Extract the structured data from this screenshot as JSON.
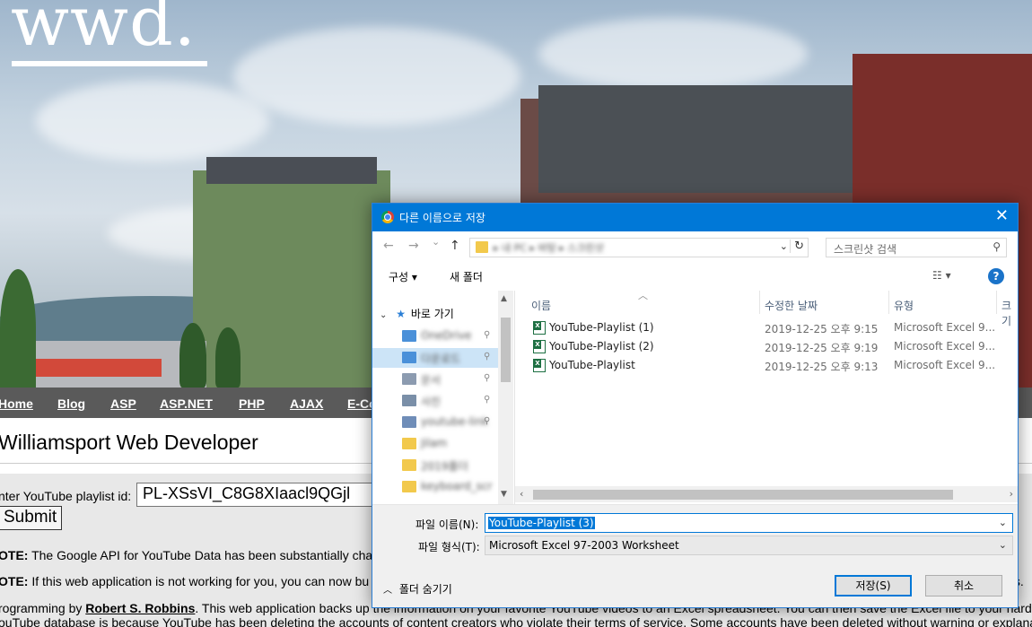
{
  "site": {
    "logo": "wwd.",
    "nav": [
      "Home",
      "Blog",
      "ASP",
      "ASP.NET",
      "PHP",
      "AJAX",
      "E-Co"
    ],
    "title": "Williamsport Web Developer",
    "playlist_label": "nter YouTube playlist id:",
    "playlist_value": "PL-XSsVI_C8G8XIaacl9QGjl",
    "submit_label": "Submit",
    "note1_bold": "OTE:",
    "note1_text": " The Google API for YouTube Data has been substantially cha",
    "note2_bold": "OTE:",
    "note2_text": " If this web application is not working for you, you can now bu",
    "note2_tail": "ts.",
    "credit_prefix": "rogramming by ",
    "credit_author": "Robert S. Robbins",
    "credit_text": ". This web application backs up the information on your favorite YouTube videos to an Excel spreadsheet. You can then save the Excel file to your hard",
    "line_last": "ouTube database is because YouTube has been deleting the accounts of content creators who violate their terms of service. Some accounts have been deleted without warning or explana"
  },
  "dialog": {
    "title": "다른 이름으로 저장",
    "close_glyph": "✕",
    "nav_back": "←",
    "nav_forward": "→",
    "nav_recent": "⌄",
    "nav_up": "↑",
    "address_path": "▸ 내 PC ▸ 바탕 ▸ 스크린샷",
    "search_placeholder": "스크린샷 검색",
    "toolbar": {
      "organize": "구성 ▾",
      "new_folder": "새 폴더",
      "view": "☷ ▾",
      "help": "?"
    },
    "nav_pane": {
      "quick_access": "바로 가기",
      "items": [
        {
          "label": "OneDrive",
          "color": "#4a90d9"
        },
        {
          "label": "다운로드",
          "color": "#4a90d9"
        },
        {
          "label": "문서",
          "color": "#8c9bb0"
        },
        {
          "label": "사진",
          "color": "#7a8fa8"
        },
        {
          "label": "youtube-link",
          "color": "#6f8db8"
        },
        {
          "label": "Jilam",
          "color": "#f2c94c"
        },
        {
          "label": "2019폴더",
          "color": "#f2c94c"
        },
        {
          "label": "keyboard_scr",
          "color": "#f2c94c"
        }
      ]
    },
    "columns": [
      "이름",
      "수정한 날짜",
      "유형",
      "크기"
    ],
    "files": [
      {
        "name": "YouTube-Playlist (1)",
        "date": "2019-12-25 오후 9:15",
        "type": "Microsoft Excel 9..."
      },
      {
        "name": "YouTube-Playlist (2)",
        "date": "2019-12-25 오후 9:19",
        "type": "Microsoft Excel 9..."
      },
      {
        "name": "YouTube-Playlist",
        "date": "2019-12-25 오후 9:13",
        "type": "Microsoft Excel 9..."
      }
    ],
    "filename_label": "파일 이름(N):",
    "filename_value": "YouTube-Playlist (3)",
    "filetype_label": "파일 형식(T):",
    "filetype_value": "Microsoft Excel 97-2003 Worksheet",
    "hide_folders": "폴더 숨기기",
    "save_label": "저장(S)",
    "cancel_label": "취소"
  }
}
